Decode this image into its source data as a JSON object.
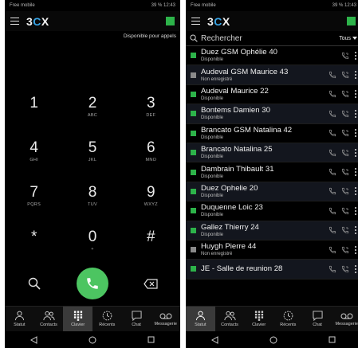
{
  "status_bar": {
    "left_text": "Free mobile",
    "right_text": "39 % 12:43"
  },
  "dialer": {
    "app_name": "3CX",
    "availability_text": "Disponible pour appels",
    "keys": [
      {
        "digit": "1",
        "letters": ""
      },
      {
        "digit": "2",
        "letters": "ABC"
      },
      {
        "digit": "3",
        "letters": "DEF"
      },
      {
        "digit": "4",
        "letters": "GHI"
      },
      {
        "digit": "5",
        "letters": "JKL"
      },
      {
        "digit": "6",
        "letters": "MNO"
      },
      {
        "digit": "7",
        "letters": "PQRS"
      },
      {
        "digit": "8",
        "letters": "TUV"
      },
      {
        "digit": "9",
        "letters": "WXYZ"
      },
      {
        "digit": "*",
        "letters": ""
      },
      {
        "digit": "0",
        "letters": "+"
      },
      {
        "digit": "#",
        "letters": ""
      }
    ]
  },
  "contacts": {
    "search_placeholder": "Rechercher",
    "filter_label": "Tous",
    "items": [
      {
        "name": "Duez GSM Ophélie 40",
        "status": "Disponible",
        "presence": "#2db34a"
      },
      {
        "name": "Audeval GSM Maurice 43",
        "status": "Non enregistré",
        "presence": "#8a8a8a"
      },
      {
        "name": "Audeval Maurice 22",
        "status": "Disponible",
        "presence": "#2db34a"
      },
      {
        "name": "Bontems Damien 30",
        "status": "Disponible",
        "presence": "#2db34a"
      },
      {
        "name": "Brancato GSM Natalina 42",
        "status": "Disponible",
        "presence": "#2db34a"
      },
      {
        "name": "Brancato Natalina 25",
        "status": "Disponible",
        "presence": "#2db34a"
      },
      {
        "name": "Dambrain Thibault 31",
        "status": "Disponible",
        "presence": "#2db34a"
      },
      {
        "name": "Duez Ophelie 20",
        "status": "Disponible",
        "presence": "#2db34a"
      },
      {
        "name": "Duquenne Loic 23",
        "status": "Disponible",
        "presence": "#2db34a"
      },
      {
        "name": "Gallez Thierry 24",
        "status": "Disponible",
        "presence": "#2db34a"
      },
      {
        "name": "Huygh Pierre 44",
        "status": "Non enregistré",
        "presence": "#8a8a8a"
      },
      {
        "name": "JE - Salle de reunion 28",
        "status": "",
        "presence": "#2db34a"
      }
    ]
  },
  "nav": {
    "tabs": [
      {
        "label": "Statut",
        "icon": "status-person-icon"
      },
      {
        "label": "Contacts",
        "icon": "contacts-icon"
      },
      {
        "label": "Clavier",
        "icon": "keypad-icon"
      },
      {
        "label": "Récents",
        "icon": "clock-icon"
      },
      {
        "label": "Chat",
        "icon": "chat-icon"
      },
      {
        "label": "Messagerie",
        "icon": "voicemail-icon"
      }
    ]
  },
  "colors": {
    "accent_green": "#2db34a",
    "call_green": "#4cc561",
    "logo_blue": "#3aa5e6",
    "offline_gray": "#8a8a8a"
  }
}
